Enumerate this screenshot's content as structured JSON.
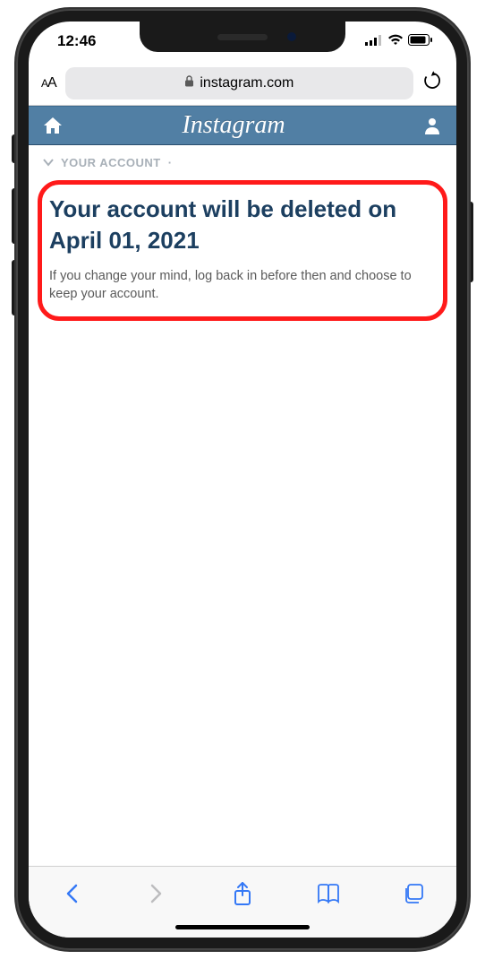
{
  "status": {
    "time": "12:46"
  },
  "safari": {
    "url_host": "instagram.com",
    "text_size_label": "AA"
  },
  "ig_header": {
    "logo_text": "Instagram"
  },
  "breadcrumb": {
    "label": "YOUR ACCOUNT",
    "separator": "·"
  },
  "content": {
    "heading": "Your account will be deleted on April 01, 2021",
    "body": "If you change your mind, log back in before then and choose to keep your account."
  },
  "colors": {
    "ig_header_bg": "#517fa4",
    "highlight_border": "#ff1a1a",
    "heading_color": "#1c3f60",
    "safari_blue": "#3478f6"
  }
}
